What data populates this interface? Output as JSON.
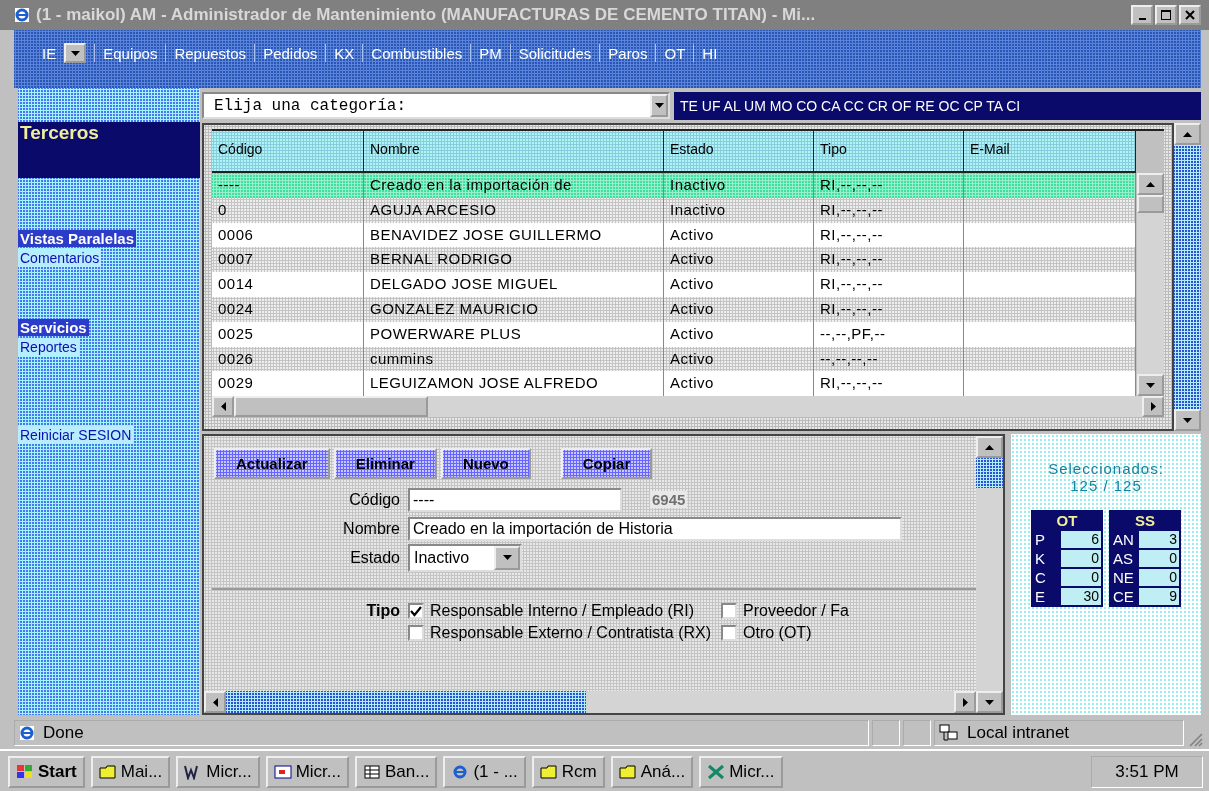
{
  "window": {
    "title": "(1 - maikol) AM - Administrador de Mantenimiento (MANUFACTURAS DE CEMENTO TITAN) - Mi..."
  },
  "menubar": {
    "ie_label": "IE",
    "items": [
      "Equipos",
      "Repuestos",
      "Pedidos",
      "KX",
      "Combustibles",
      "PM",
      "Solicitudes",
      "Paros",
      "OT",
      "HI"
    ]
  },
  "category": {
    "value": "Elija una categoría:",
    "codes": "TE UF AL UM MO CO CA CC CR OF RE OC CP TA CI"
  },
  "sidebar": {
    "title": "Terceros",
    "items": [
      {
        "text": "Vistas Paralelas",
        "kind": "heading"
      },
      {
        "text": "Comentarios",
        "kind": "link"
      },
      {
        "text": "Servicios",
        "kind": "heading"
      },
      {
        "text": "Reportes",
        "kind": "link"
      },
      {
        "text": "Reiniciar SESION",
        "kind": "link"
      }
    ]
  },
  "table": {
    "columns": [
      "Código",
      "Nombre",
      "Estado",
      "Tipo",
      "E-Mail"
    ],
    "rows": [
      {
        "cells": [
          "----",
          "Creado en la importación de",
          "Inactivo",
          "RI,--,--,--",
          ""
        ],
        "selected": true
      },
      {
        "cells": [
          "0",
          "AGUJA ARCESIO",
          "Inactivo",
          "RI,--,--,--",
          ""
        ],
        "selected": false
      },
      {
        "cells": [
          "0006",
          "BENAVIDEZ JOSE GUILLERMO",
          "Activo",
          "RI,--,--,--",
          ""
        ],
        "selected": false
      },
      {
        "cells": [
          "0007",
          "BERNAL RODRIGO",
          "Activo",
          "RI,--,--,--",
          ""
        ],
        "selected": false
      },
      {
        "cells": [
          "0014",
          "DELGADO JOSE MIGUEL",
          "Activo",
          "RI,--,--,--",
          ""
        ],
        "selected": false
      },
      {
        "cells": [
          "0024",
          "GONZALEZ MAURICIO",
          "Activo",
          "RI,--,--,--",
          ""
        ],
        "selected": false
      },
      {
        "cells": [
          "0025",
          "POWERWARE PLUS",
          "Activo",
          "--,--,PF,--",
          ""
        ],
        "selected": false
      },
      {
        "cells": [
          "0026",
          "cummins",
          "Activo",
          "--,--,--,--",
          ""
        ],
        "selected": false
      },
      {
        "cells": [
          "0029",
          "LEGUIZAMON JOSE ALFREDO",
          "Activo",
          "RI,--,--,--",
          ""
        ],
        "selected": false
      }
    ]
  },
  "form": {
    "buttons": [
      "Actualizar",
      "Eliminar",
      "Nuevo",
      "Copiar"
    ],
    "codigo_label": "Código",
    "codigo": "----",
    "count": "6945",
    "nombre_label": "Nombre",
    "nombre": "Creado en la importación de Historia",
    "estado_label": "Estado",
    "estado": "Inactivo",
    "tipo_label": "Tipo",
    "checkboxes": [
      {
        "label": "Responsable Interno / Empleado (RI)",
        "checked": true
      },
      {
        "label": "Proveedor / Fa",
        "checked": false
      },
      {
        "label": "Responsable Externo / Contratista (RX)",
        "checked": false
      },
      {
        "label": "Otro (OT)",
        "checked": false
      }
    ]
  },
  "stats": {
    "label": "Seleccionados:",
    "count": "125  /  125",
    "groups": [
      {
        "title": "OT",
        "rows": [
          {
            "key": "P",
            "value": "6"
          },
          {
            "key": "K",
            "value": "0"
          },
          {
            "key": "C",
            "value": "0"
          },
          {
            "key": "E",
            "value": "30"
          }
        ]
      },
      {
        "title": "SS",
        "rows": [
          {
            "key": "AN",
            "value": "3"
          },
          {
            "key": "AS",
            "value": "0"
          },
          {
            "key": "NE",
            "value": "0"
          },
          {
            "key": "CE",
            "value": "9"
          }
        ]
      }
    ]
  },
  "status_bar": {
    "text": "Done",
    "zone": "Local intranet"
  },
  "taskbar": {
    "start": "Start",
    "tasks": [
      "Mai...",
      "Micr...",
      "Micr...",
      "Ban...",
      "(1 - ...",
      "Rcm",
      "Aná...",
      "Micr..."
    ],
    "clock": "3:51 PM"
  }
}
